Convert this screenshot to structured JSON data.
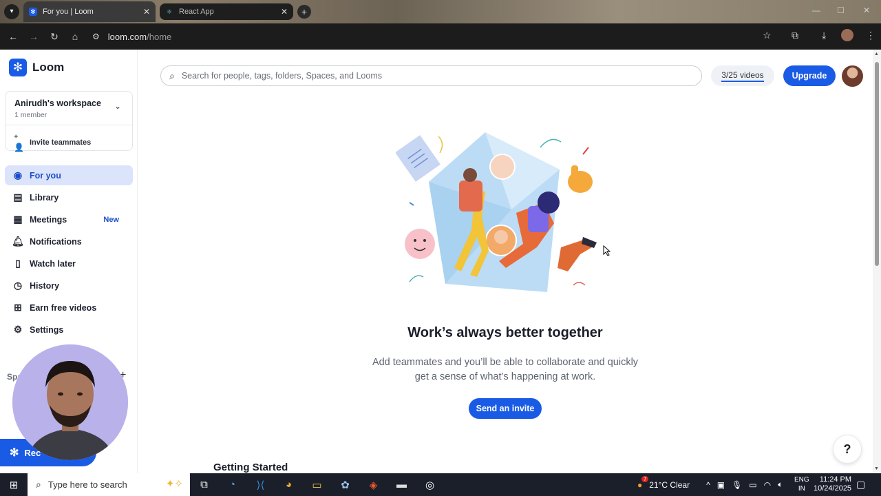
{
  "browser": {
    "tabs": [
      {
        "title": "For you | Loom",
        "active": true
      },
      {
        "title": "React App",
        "active": false
      }
    ],
    "new_tab": "+",
    "url_host": "loom.com",
    "url_path": "/home"
  },
  "brand": {
    "name": "Loom",
    "accent": "#1a5be5"
  },
  "workspace": {
    "name": "Anirudh's workspace",
    "members": "1 member",
    "invite_label": "Invite teammates"
  },
  "nav": [
    {
      "label": "For you",
      "icon": "user-circle-icon",
      "active": true
    },
    {
      "label": "Library",
      "icon": "library-icon"
    },
    {
      "label": "Meetings",
      "icon": "calendar-icon",
      "badge": "New"
    },
    {
      "label": "Notifications",
      "icon": "bell-icon"
    },
    {
      "label": "Watch later",
      "icon": "bookmark-icon"
    },
    {
      "label": "History",
      "icon": "clock-icon"
    },
    {
      "label": "Earn free videos",
      "icon": "gift-icon"
    },
    {
      "label": "Settings",
      "icon": "gear-icon"
    }
  ],
  "spaces": {
    "label": "Spa",
    "add": "+"
  },
  "record_button": {
    "label": "Rec"
  },
  "header": {
    "search_placeholder": "Search for people, tags, folders, Spaces, and Looms",
    "quota": "3/25 videos",
    "upgrade_label": "Upgrade"
  },
  "empty_state": {
    "headline": "Work’s always better together",
    "subtext": "Add teammates and you’ll be able to collaborate and quickly get a sense of what’s happening at work.",
    "cta": "Send an invite"
  },
  "section_title": "Getting Started",
  "help_label": "?",
  "taskbar": {
    "search_placeholder": "Type here to search",
    "weather": "21°C  Clear",
    "weather_badge": "7",
    "lang_top": "ENG",
    "lang_bottom": "IN",
    "time": "11:24 PM",
    "date": "10/24/2025"
  }
}
